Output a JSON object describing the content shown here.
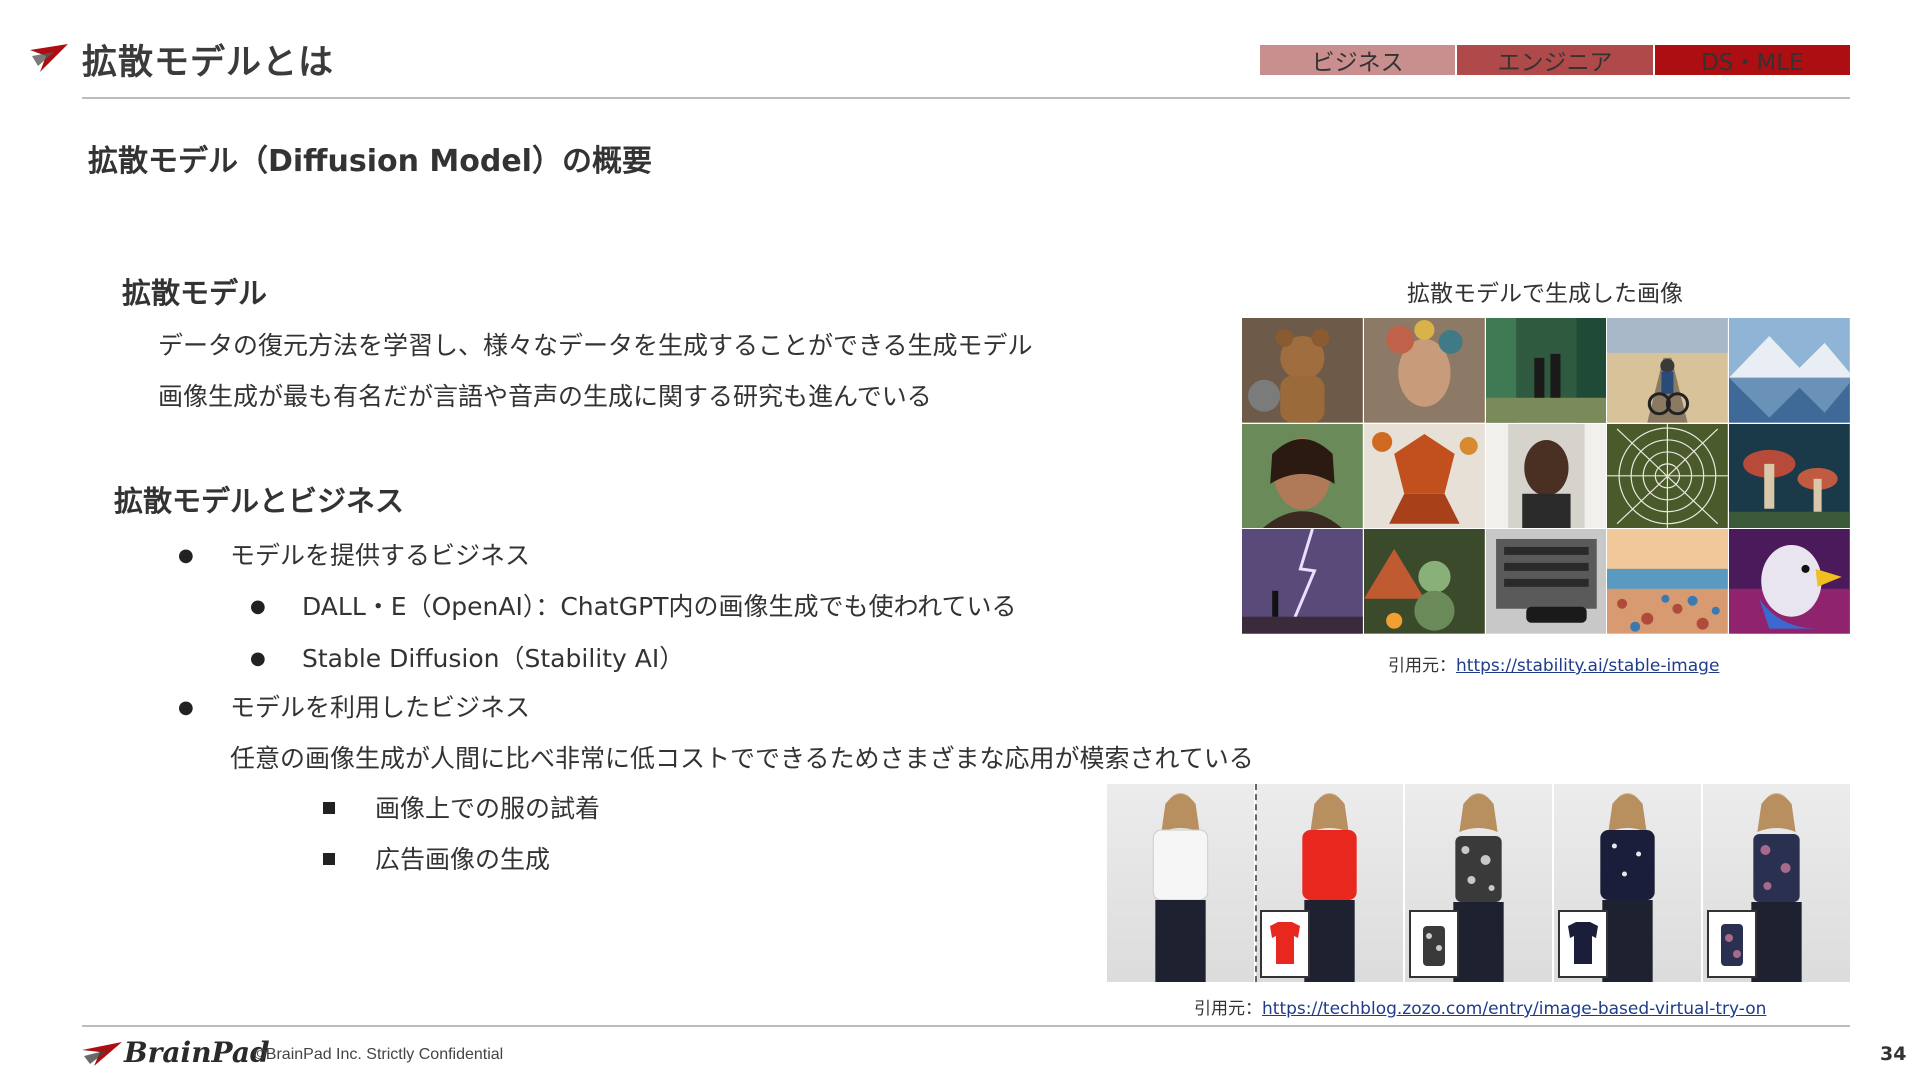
{
  "header": {
    "title": "拡散モデルとは",
    "tags": [
      "ビジネス",
      "エンジニア",
      "DS・MLE"
    ],
    "accent": "#ad0e12"
  },
  "subtitle": "拡散モデル（Diffusion Model）の概要",
  "section1": {
    "heading": "拡散モデル",
    "lines": [
      "データの復元方法を学習し、様々なデータを生成することができる生成モデル",
      "画像生成が最も有名だが言語や音声の生成に関する研究も進んでいる"
    ]
  },
  "section2": {
    "heading": "拡散モデルとビジネス",
    "item1": "モデルを提供するビジネス",
    "sub1": "DALL・E（OpenAI）：ChatGPT内の画像生成でも使われている",
    "sub2": "Stable Diffusion（Stability AI）",
    "item2": "モデルを利用したビジネス",
    "item2_desc": "任意の画像生成が人間に比べ非常に低コストでできるためさまざまな応用が模索されている",
    "sq1": "画像上での服の試着",
    "sq2": "広告画像の生成"
  },
  "figure1": {
    "caption": "拡散モデルで生成した画像",
    "source_label": "引用元：",
    "source_url": "https://stability.ai/stable-image"
  },
  "figure2": {
    "source_label": "引用元：",
    "source_url": "https://techblog.zozo.com/entry/image-based-virtual-try-on"
  },
  "footer": {
    "brand": "BrainPad",
    "copyright": "©BrainPad Inc.  Strictly Confidential",
    "page": "34"
  }
}
